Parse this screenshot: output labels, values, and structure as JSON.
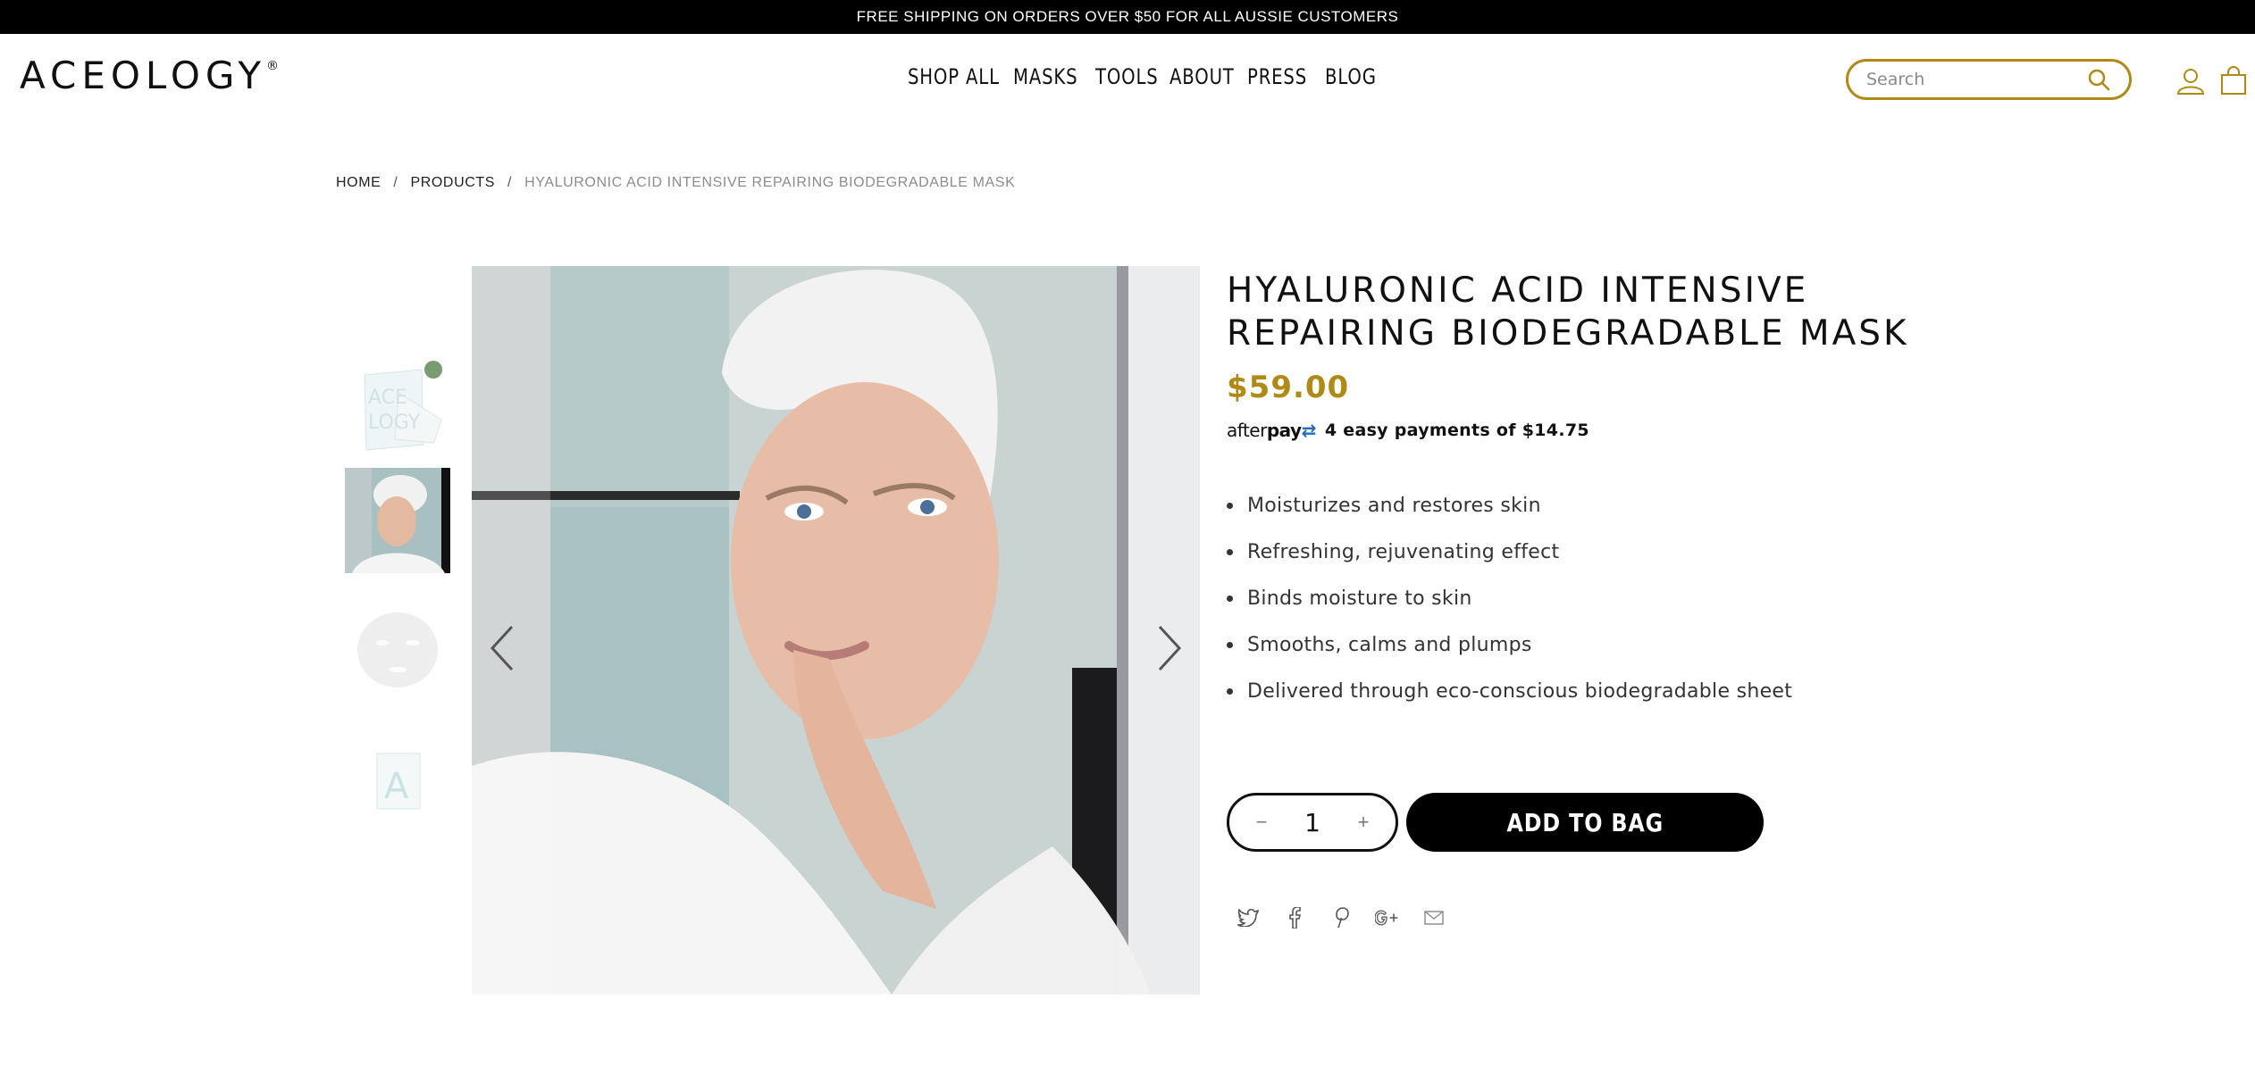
{
  "announcement": "FREE SHIPPING ON ORDERS OVER $50 FOR ALL AUSSIE CUSTOMERS",
  "brand": {
    "name": "ACEOLOGY",
    "mark": "®"
  },
  "nav": [
    {
      "label": "SHOP ALL"
    },
    {
      "label": "MASKS"
    },
    {
      "label": "TOOLS"
    },
    {
      "label": "ABOUT"
    },
    {
      "label": "PRESS"
    },
    {
      "label": "BLOG"
    }
  ],
  "search": {
    "placeholder": "Search",
    "value": ""
  },
  "icons": {
    "search": "search-icon",
    "account": "user-icon",
    "cart": "shopping-bag-icon"
  },
  "breadcrumb": {
    "home": "HOME",
    "sep": "/",
    "products": "PRODUCTS",
    "current": "HYALURONIC ACID INTENSIVE REPAIRING BIODEGRADABLE MASK"
  },
  "product": {
    "title_line1": "HYALURONIC ACID INTENSIVE",
    "title_line2": "REPAIRING BIODEGRADABLE MASK",
    "price": "$59.00",
    "afterpay": {
      "logo_pre": "after",
      "logo_bold": "pay",
      "text": "4 easy payments of $14.75"
    },
    "features": [
      "Moisturizes and restores skin",
      "Refreshing, rejuvenating effect",
      "Binds moisture to skin",
      "Smooths, calms and plumps",
      "Delivered through eco-conscious biodegradable sheet"
    ],
    "quantity": "1",
    "qty_minus": "−",
    "qty_plus": "+",
    "add_to_bag": "ADD TO BAG"
  },
  "share": [
    "twitter-icon",
    "facebook-icon",
    "pinterest-icon",
    "google-plus-icon",
    "email-icon"
  ],
  "colors": {
    "accent": "#b08a16",
    "black": "#000000"
  }
}
